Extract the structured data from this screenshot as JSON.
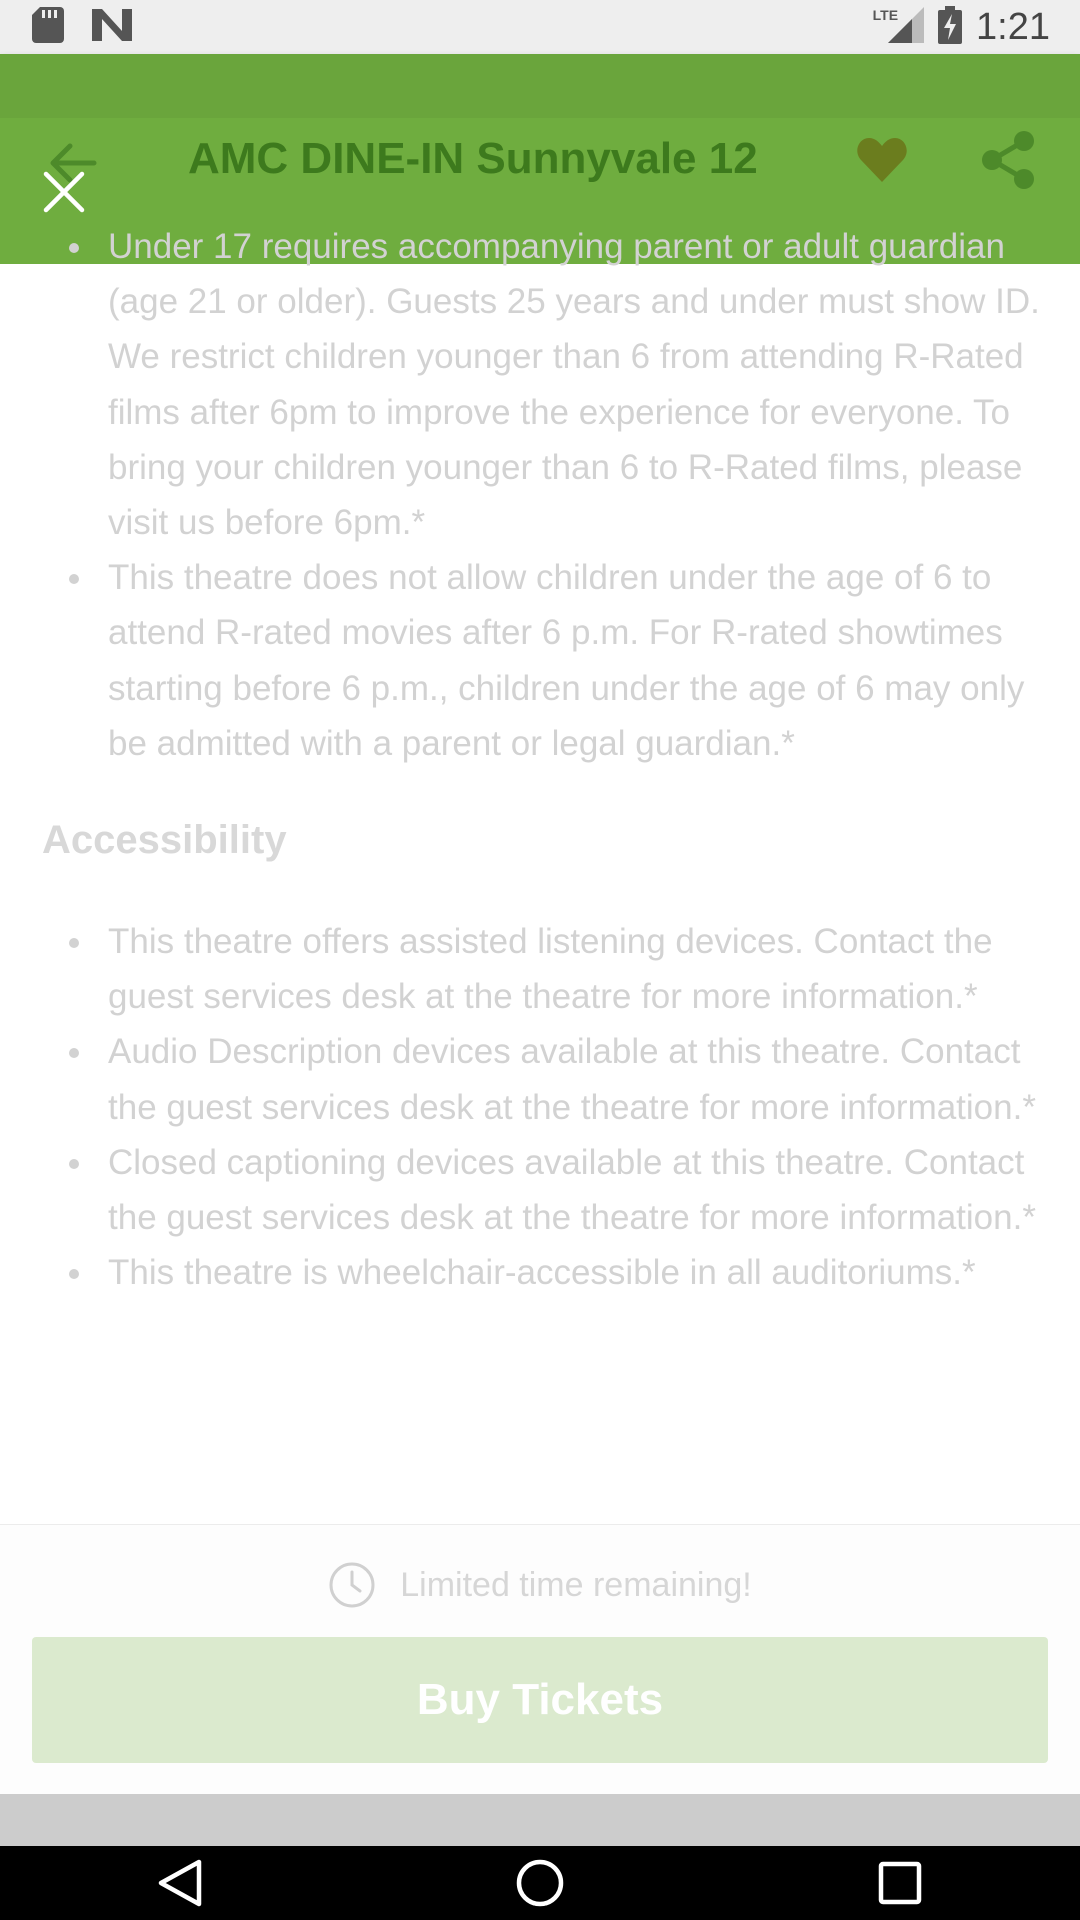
{
  "status_bar": {
    "network": "LTE",
    "time": "1:21"
  },
  "header": {
    "title": "AMC DINE-IN Sunnyvale 12"
  },
  "policies": {
    "items": [
      "Under 17 requires accompanying parent or adult guardian (age 21 or older). Guests 25 years and under must show ID. We restrict children younger than 6 from attending R-Rated films after 6pm to improve the experience for everyone. To bring your children younger than 6 to R-Rated films, please visit us before 6pm.*",
      "This theatre does not allow children under the age of 6 to attend R-rated movies after 6 p.m. For R-rated showtimes starting before 6 p.m., children under the age of 6 may only be admitted with a parent or legal guardian.*"
    ]
  },
  "accessibility": {
    "title": "Accessibility",
    "items": [
      "This theatre offers assisted listening devices. Contact the guest services desk at the theatre for more information.*",
      "Audio Description devices available at this theatre. Contact the guest services desk at the theatre for more information.*",
      "Closed captioning devices available at this theatre. Contact the guest services desk at the theatre for more information.*",
      "This theatre is wheelchair-accessible in all auditoriums.*"
    ]
  },
  "buy_panel": {
    "limited_text": "Limited time remaining!",
    "button_label": "Buy Tickets"
  },
  "colors": {
    "app_bar": "#6fad3f",
    "title_text": "#3d7a1d",
    "heart": "#6b7d1e",
    "buy_button": "#dbeace"
  },
  "icons": {
    "back": "arrow-left-icon",
    "favorite": "heart-icon",
    "share": "share-icon",
    "close": "close-icon",
    "clock": "clock-icon"
  }
}
